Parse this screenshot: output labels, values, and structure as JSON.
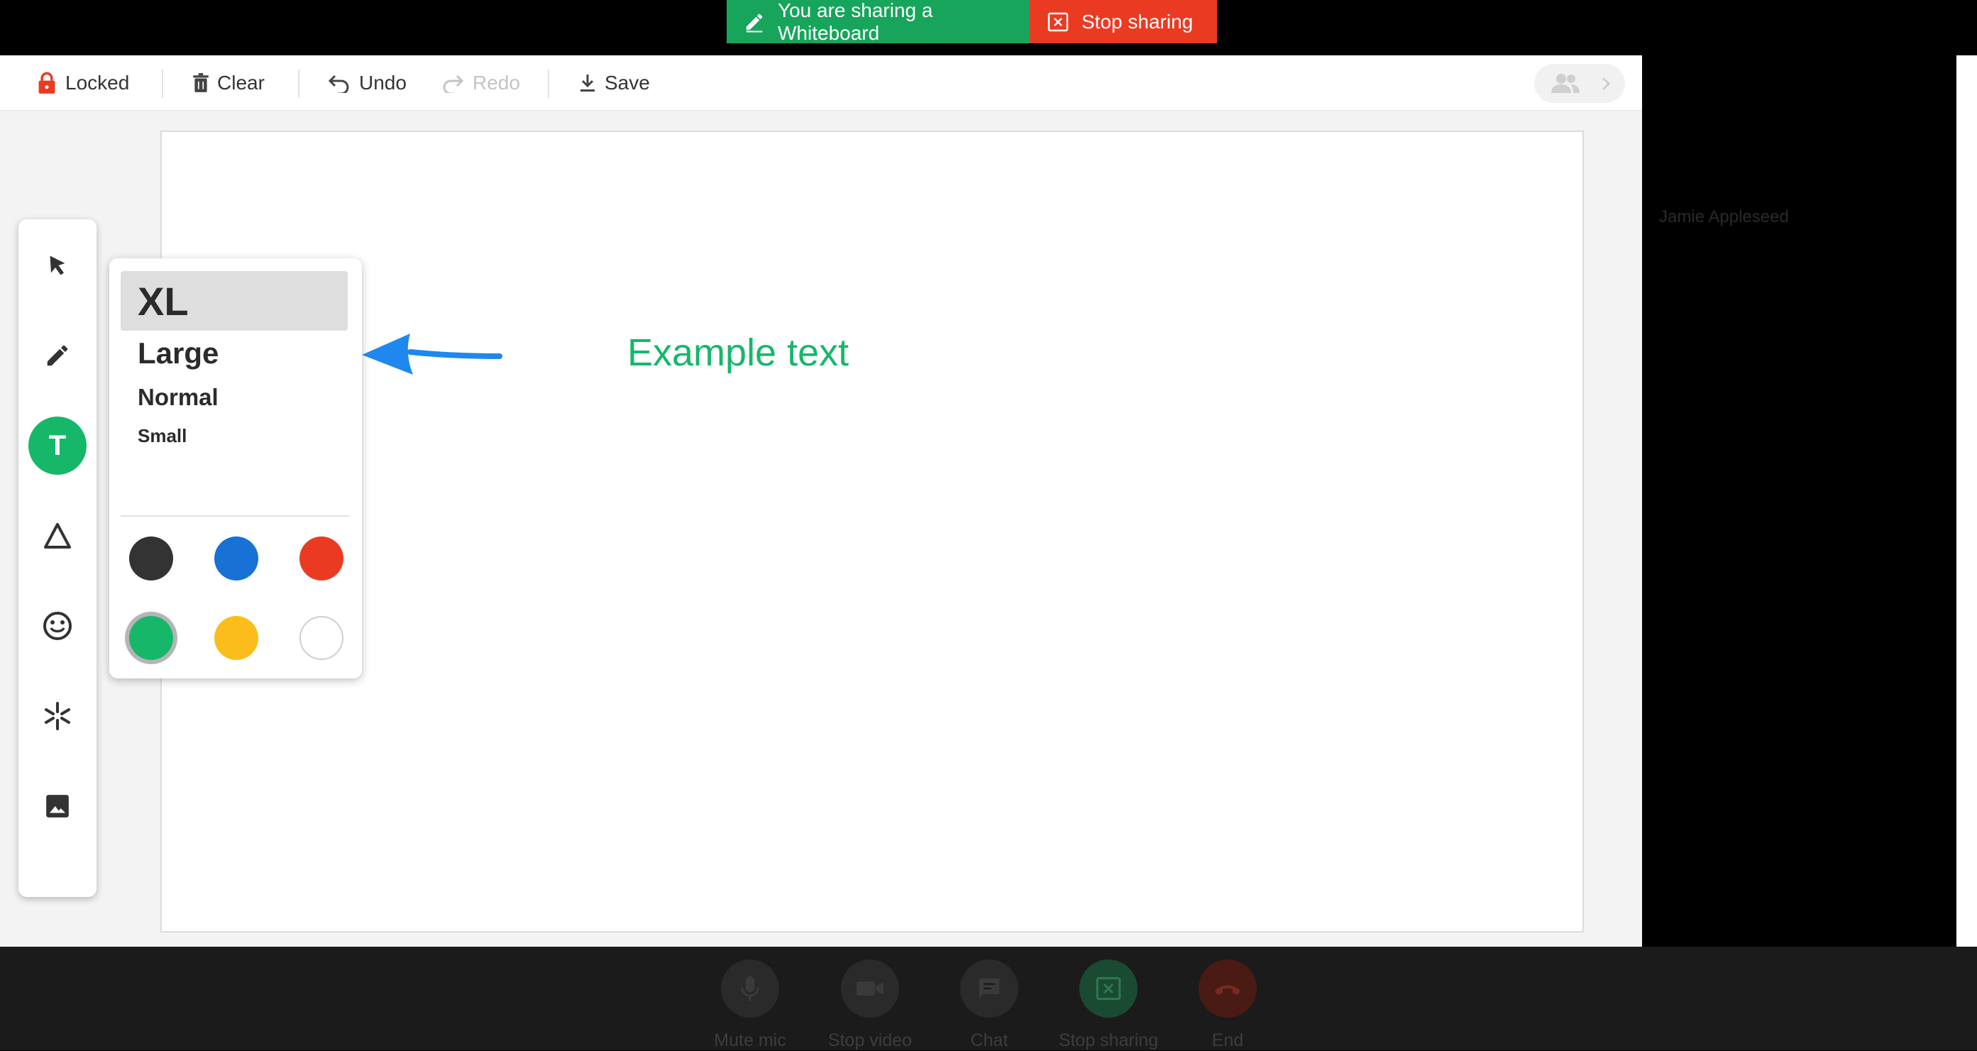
{
  "banner": {
    "sharing_text": "You are sharing a Whiteboard",
    "stop_label": "Stop sharing",
    "sharing_color": "#17a55c",
    "stop_color": "#ea3b22"
  },
  "toolbar": {
    "lock_label": "Locked",
    "clear_label": "Clear",
    "undo_label": "Undo",
    "redo_label": "Redo",
    "save_label": "Save"
  },
  "tools": [
    {
      "icon": "cursor-arrow-icon"
    },
    {
      "icon": "pencil-icon"
    },
    {
      "icon": "text-tool-icon",
      "glyph": "T",
      "active": true
    },
    {
      "icon": "triangle-shape-icon"
    },
    {
      "icon": "emoji-smile-icon"
    },
    {
      "icon": "asterisk-stamp-icon"
    },
    {
      "icon": "image-icon"
    }
  ],
  "text_popover": {
    "sizes": [
      {
        "label": "XL",
        "selected": true
      },
      {
        "label": "Large"
      },
      {
        "label": "Normal"
      },
      {
        "label": "Small"
      }
    ],
    "colors": [
      {
        "name": "black",
        "hex": "#333333"
      },
      {
        "name": "blue",
        "hex": "#1871d4"
      },
      {
        "name": "red",
        "hex": "#ea3b22"
      },
      {
        "name": "green",
        "hex": "#17b76a",
        "selected": true
      },
      {
        "name": "yellow",
        "hex": "#fbbd1c"
      },
      {
        "name": "white",
        "hex": "#ffffff"
      }
    ]
  },
  "canvas": {
    "example_text": "Example text",
    "text_color": "#17b76a"
  },
  "side_pane": {
    "participant_name": "Jamie Appleseed"
  },
  "call_controls": [
    {
      "label": "Mute mic",
      "icon": "microphone-icon"
    },
    {
      "label": "Stop video",
      "icon": "video-camera-icon"
    },
    {
      "label": "Chat",
      "icon": "chat-bubble-icon"
    },
    {
      "label": "Stop sharing",
      "icon": "stop-share-icon"
    },
    {
      "label": "End",
      "icon": "hang-up-icon"
    }
  ]
}
